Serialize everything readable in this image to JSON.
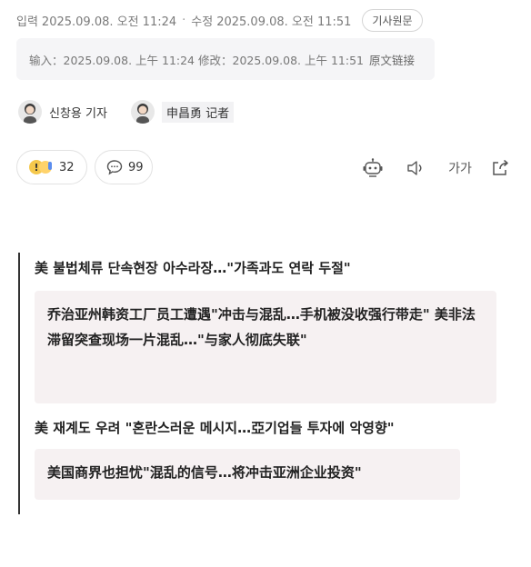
{
  "meta": {
    "input_label": "입력",
    "input_date": "2025.09.08. 오전 11:24",
    "modified_label": "수정",
    "modified_date": "2025.09.08. 오전 11:51",
    "original_button": "기사원문"
  },
  "translation": {
    "text": "输入：2025.09.08. 上午 11:24 修改：2025.09.08. 上午 11:51",
    "link_label": "原文链接"
  },
  "reporters": [
    {
      "name": "신창용 기자"
    },
    {
      "name": "申昌勇 记者"
    }
  ],
  "toolbar": {
    "reaction_count": "32",
    "comment_count": "99",
    "font_size_label": "가가",
    "icons": [
      "reaction-icon",
      "comment-icon",
      "robot-icon",
      "speaker-icon",
      "font-size-icon",
      "share-icon"
    ]
  },
  "related": [
    {
      "title": "美 불법체류 단속현장 아수라장…\"가족과도 연락 두절\"",
      "translation": "乔治亚州韩资工厂员工遭遇\"冲击与混乱…手机被没收强行带走\" 美非法滞留突查现场一片混乱…\"与家人彻底失联\""
    },
    {
      "title": "美 재계도 우려 \"혼란스러운 메시지…亞기업들 투자에 악영향\"",
      "translation": "美国商界也担忧\"混乱的信号…将冲击亚洲企业投资\""
    }
  ],
  "colors": {
    "translation_bg": "#f6f1f2",
    "meta_box_bg": "#f5f5f7"
  }
}
